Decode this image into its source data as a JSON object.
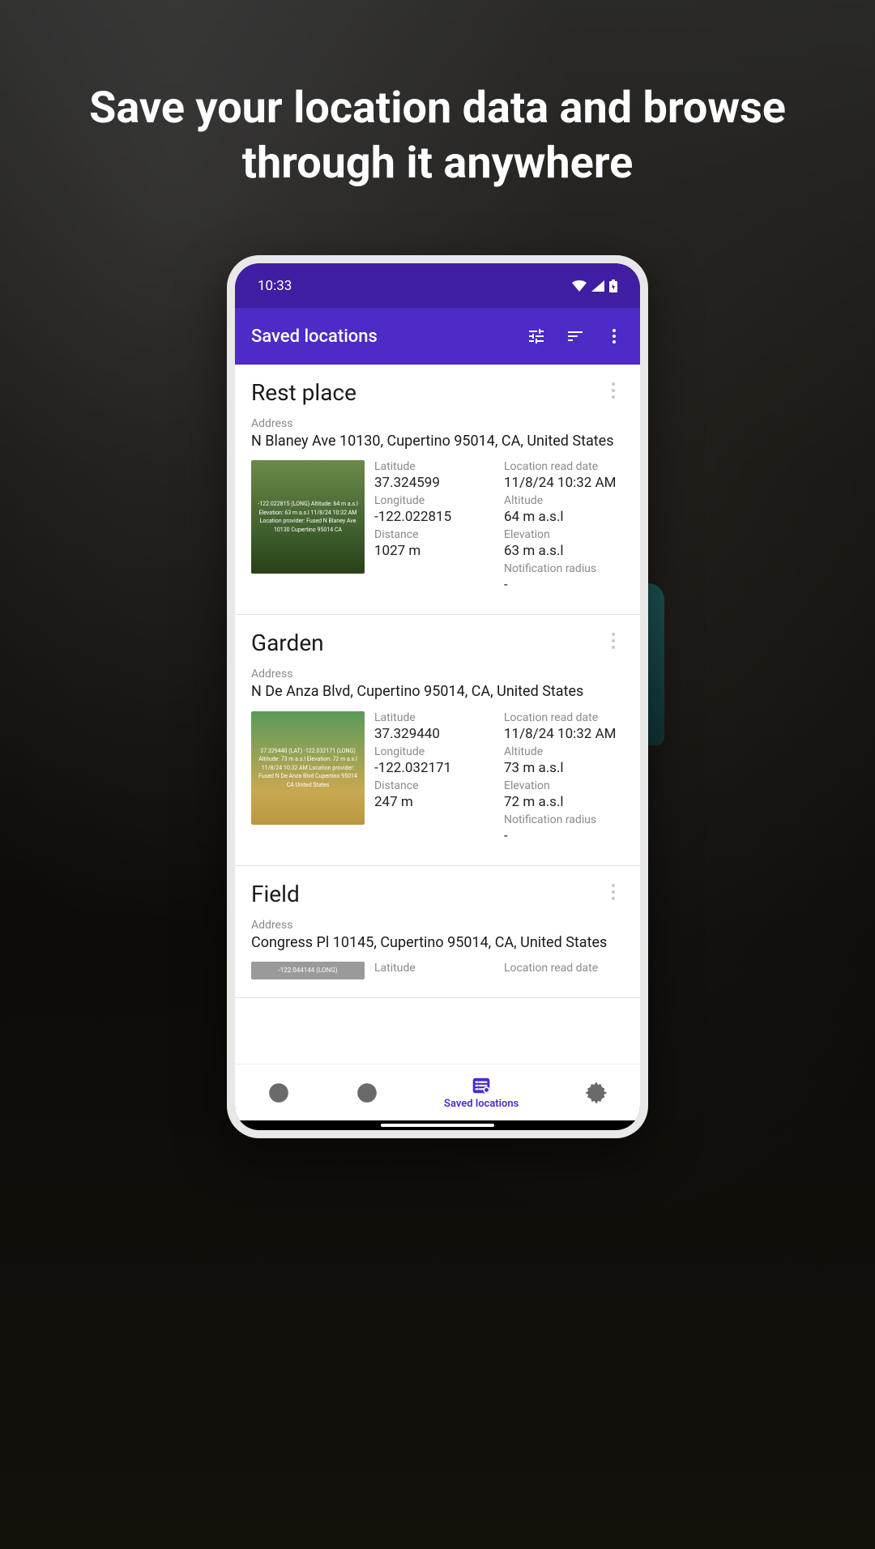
{
  "headline": "Save your location data and browse through it anywhere",
  "statusBar": {
    "time": "10:33"
  },
  "appBar": {
    "title": "Saved locations"
  },
  "labels": {
    "address": "Address",
    "latitude": "Latitude",
    "longitude": "Longitude",
    "distance": "Distance",
    "readDate": "Location read date",
    "altitude": "Altitude",
    "elevation": "Elevation",
    "notifRadius": "Notification radius"
  },
  "locations": [
    {
      "name": "Rest place",
      "address": "N Blaney Ave 10130, Cupertino 95014, CA, United States",
      "latitude": "37.324599",
      "longitude": "-122.022815",
      "distance": "1027 m",
      "readDate": "11/8/24 10:32 AM",
      "altitude": "64 m a.s.l",
      "elevation": "63 m a.s.l",
      "notifRadius": "-",
      "thumbText": "-122.022815 (LONG)\nAltitude: 64 m a.s.l\nElevation: 63 m a.s.l\n11/8/24 10:32 AM\nLocation provider: Fused\nN Blaney Ave 10130\nCupertino 95014\nCA"
    },
    {
      "name": "Garden",
      "address": "N De Anza Blvd, Cupertino 95014, CA, United States",
      "latitude": "37.329440",
      "longitude": "-122.032171",
      "distance": "247 m",
      "readDate": "11/8/24 10:32 AM",
      "altitude": "73 m a.s.l",
      "elevation": "72 m a.s.l",
      "notifRadius": "-",
      "thumbText": "37.329440 (LAT)\n-122.032171 (LONG)\nAltitude: 73 m a.s.l\nElevation: 72 m a.s.l\n11/8/24 10:32 AM\nLocation provider: Fused\nN De Anza Blvd\nCupertino 95014\nCA\nUnited States"
    },
    {
      "name": "Field",
      "address": "Congress Pl 10145, Cupertino 95014, CA, United States",
      "latitude": "",
      "longitude": "",
      "distance": "",
      "readDate": "",
      "altitude": "",
      "elevation": "",
      "notifRadius": "",
      "thumbText": "-122.044144 (LONG)"
    }
  ],
  "bottomNav": {
    "activeLabel": "Saved locations"
  }
}
